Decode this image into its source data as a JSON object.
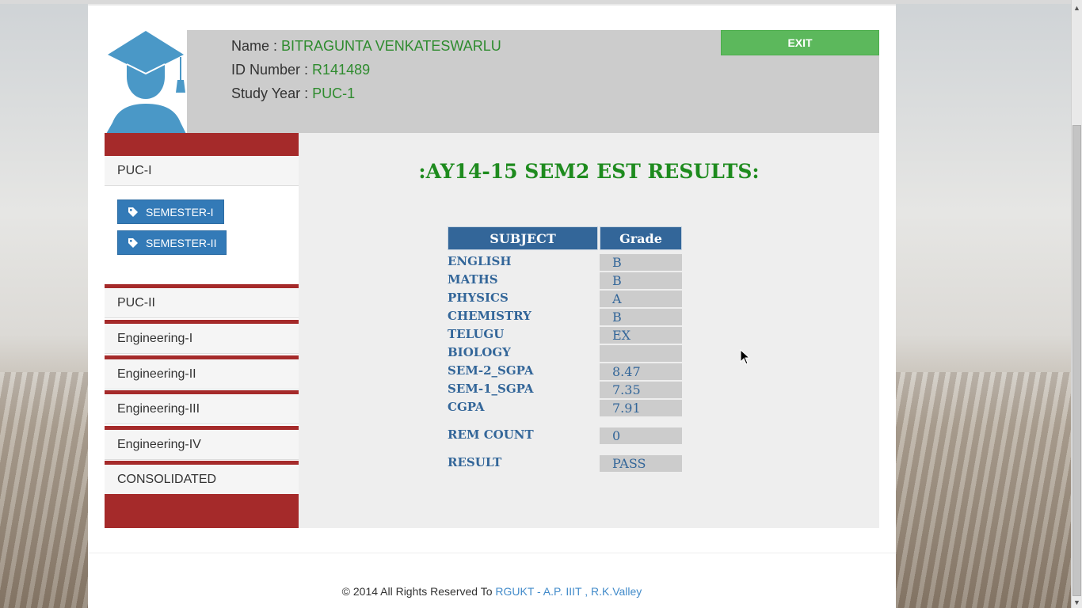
{
  "student": {
    "name_label": "Name : ",
    "name": "BITRAGUNTA VENKATESWARLU",
    "id_label": "ID Number : ",
    "id": "R141489",
    "year_label": "Study Year : ",
    "year": "PUC-1"
  },
  "header": {
    "exit_label": "EXIT"
  },
  "sidebar": {
    "puc1": "PUC-I",
    "semesters": [
      "SEMESTER-I",
      "SEMESTER-II"
    ],
    "puc2": "PUC-II",
    "eng1": "Engineering-I",
    "eng2": "Engineering-II",
    "eng3": "Engineering-III",
    "eng4": "Engineering-IV",
    "consolidated": "CONSOLIDATED"
  },
  "results": {
    "title": ":AY14-15 SEM2 EST RESULTS:",
    "col_subject": "SUBJECT",
    "col_grade": "Grade",
    "rows": [
      {
        "subject": "ENGLISH",
        "grade": "B"
      },
      {
        "subject": "MATHS",
        "grade": "B"
      },
      {
        "subject": "PHYSICS",
        "grade": "A"
      },
      {
        "subject": "CHEMISTRY",
        "grade": "B"
      },
      {
        "subject": "TELUGU",
        "grade": "EX"
      },
      {
        "subject": "BIOLOGY",
        "grade": ""
      },
      {
        "subject": "SEM-2_SGPA",
        "grade": "8.47"
      },
      {
        "subject": "SEM-1_SGPA",
        "grade": "7.35"
      },
      {
        "subject": "CGPA",
        "grade": "7.91"
      }
    ],
    "rem_label": "REM COUNT",
    "rem_value": "0",
    "result_label": "RESULT",
    "result_value": "PASS"
  },
  "footer": {
    "text": "© 2014 All Rights Reserved To ",
    "link": "RGUKT - A.P. IIIT , R.K.Valley"
  },
  "colors": {
    "accent_red": "#a52a2a",
    "accent_green": "#1e8b1e",
    "button_blue": "#337ab7",
    "exit_green": "#5cb85c"
  },
  "icons": [
    "graduate-avatar-icon",
    "tag-icon",
    "mouse-cursor-icon"
  ]
}
